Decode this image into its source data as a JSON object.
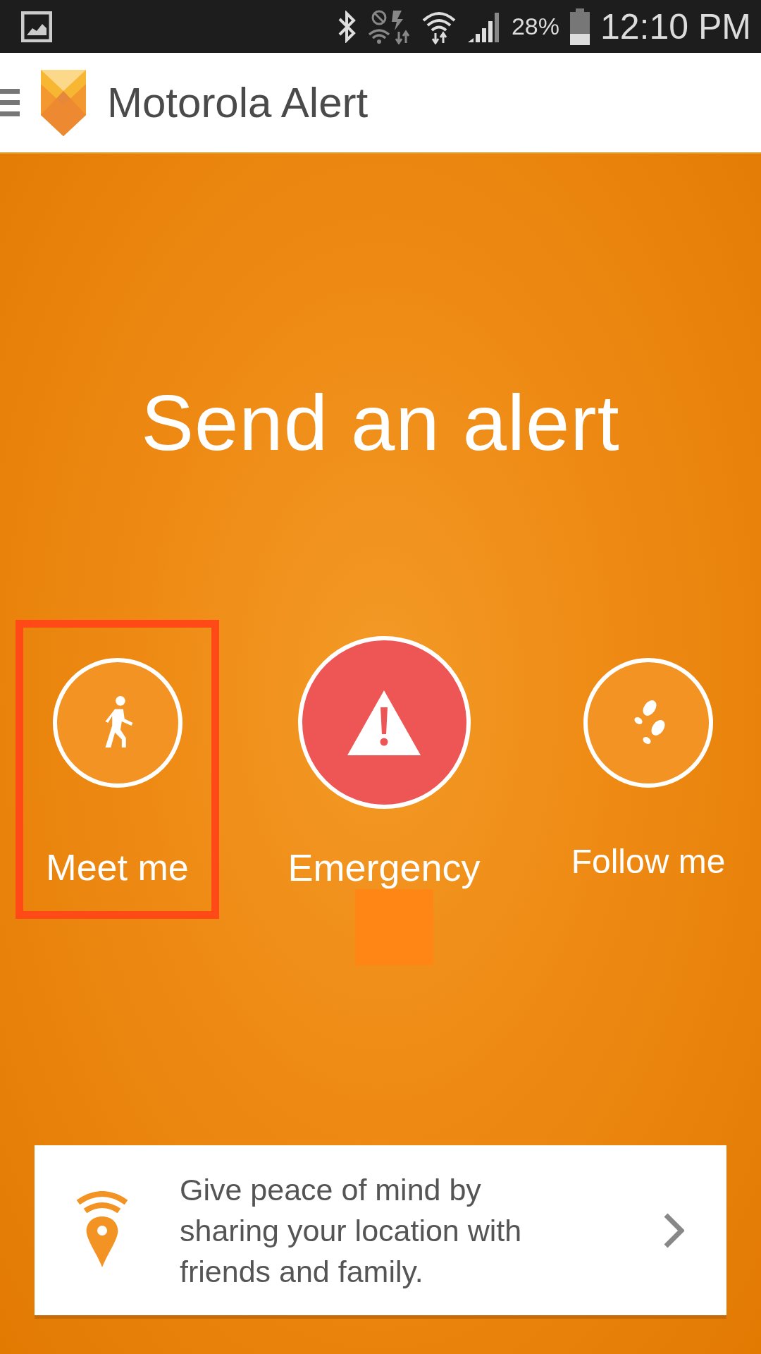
{
  "status_bar": {
    "battery": "28%",
    "time": "12:10 PM"
  },
  "app_bar": {
    "title": "Motorola Alert"
  },
  "heading": "Send an alert",
  "actions": [
    {
      "label": "Meet me",
      "kind": "walk",
      "highlighted": true
    },
    {
      "label": "Emergency",
      "kind": "emergency",
      "highlighted": false
    },
    {
      "label": "Follow me",
      "kind": "footsteps",
      "highlighted": false
    }
  ],
  "banner": {
    "text": "Give peace of mind by\nsharing your location with\nfriends and family."
  }
}
